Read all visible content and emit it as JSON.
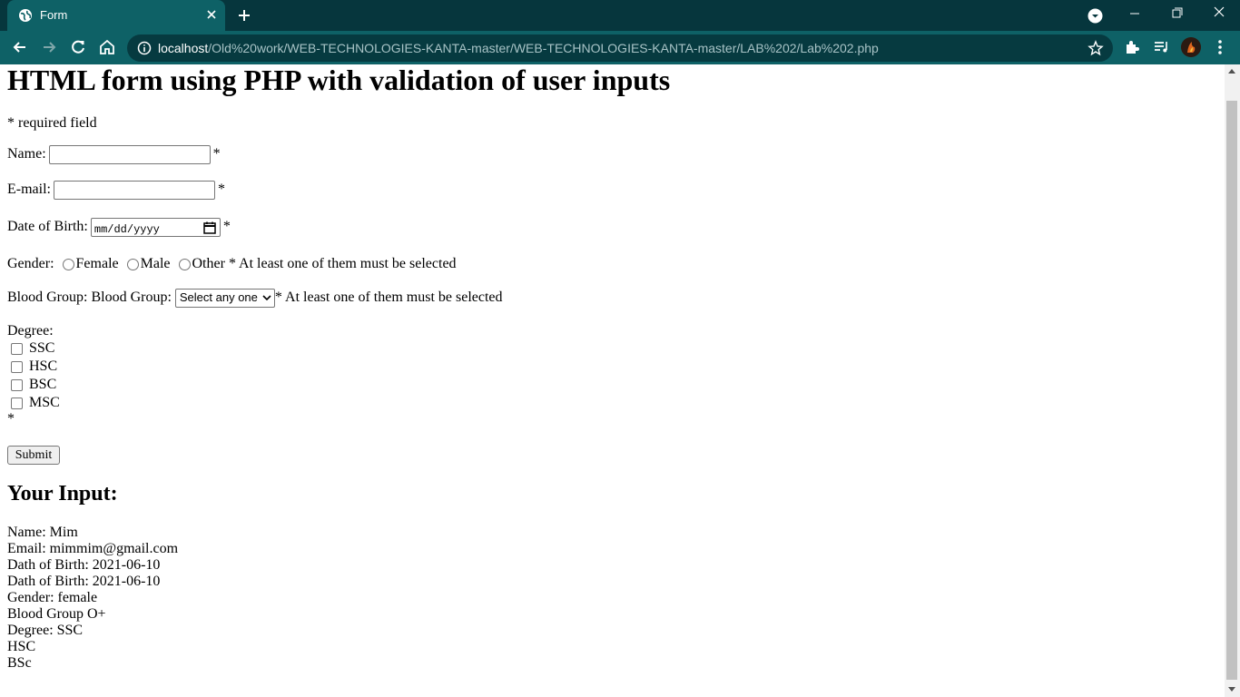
{
  "browser": {
    "tab_title": "Form",
    "url_host": "localhost",
    "url_path": "/Old%20work/WEB-TECHNOLOGIES-KANTA-master/WEB-TECHNOLOGIES-KANTA-master/LAB%202/Lab%202.php"
  },
  "page": {
    "heading": "HTML form using PHP with validation of user inputs",
    "required_note": "* required field",
    "name_label": "Name:",
    "name_value": "",
    "email_label": "E-mail:",
    "email_value": "",
    "dob_label": "Date of Birth:",
    "dob_placeholder": "mm/dd/yyyy",
    "required_mark": "*",
    "gender_label": "Gender:",
    "gender_options": [
      "Female",
      "Male",
      "Other"
    ],
    "gender_note": "* At least one of them must be selected",
    "blood_label": "Blood Group: Blood Group:",
    "blood_select_value": "Select any one",
    "blood_note": "* At least one of them must be selected",
    "degree_label": "Degree:",
    "degree_options": [
      "SSC",
      "HSC",
      "BSC",
      "MSC"
    ],
    "degree_required": "*",
    "submit_label": "Submit",
    "output_heading": "Your Input:",
    "output_lines": [
      "Name: Mim",
      "Email: mimmim@gmail.com",
      "Dath of Birth: 2021-06-10",
      "Dath of Birth: 2021-06-10",
      "Gender: female",
      "Blood Group O+",
      "Degree: SSC",
      "HSC",
      "BSc"
    ]
  },
  "colors": {
    "titlebar": "#06363d",
    "toolbar": "#0e6166",
    "omnibox": "#063a40"
  }
}
